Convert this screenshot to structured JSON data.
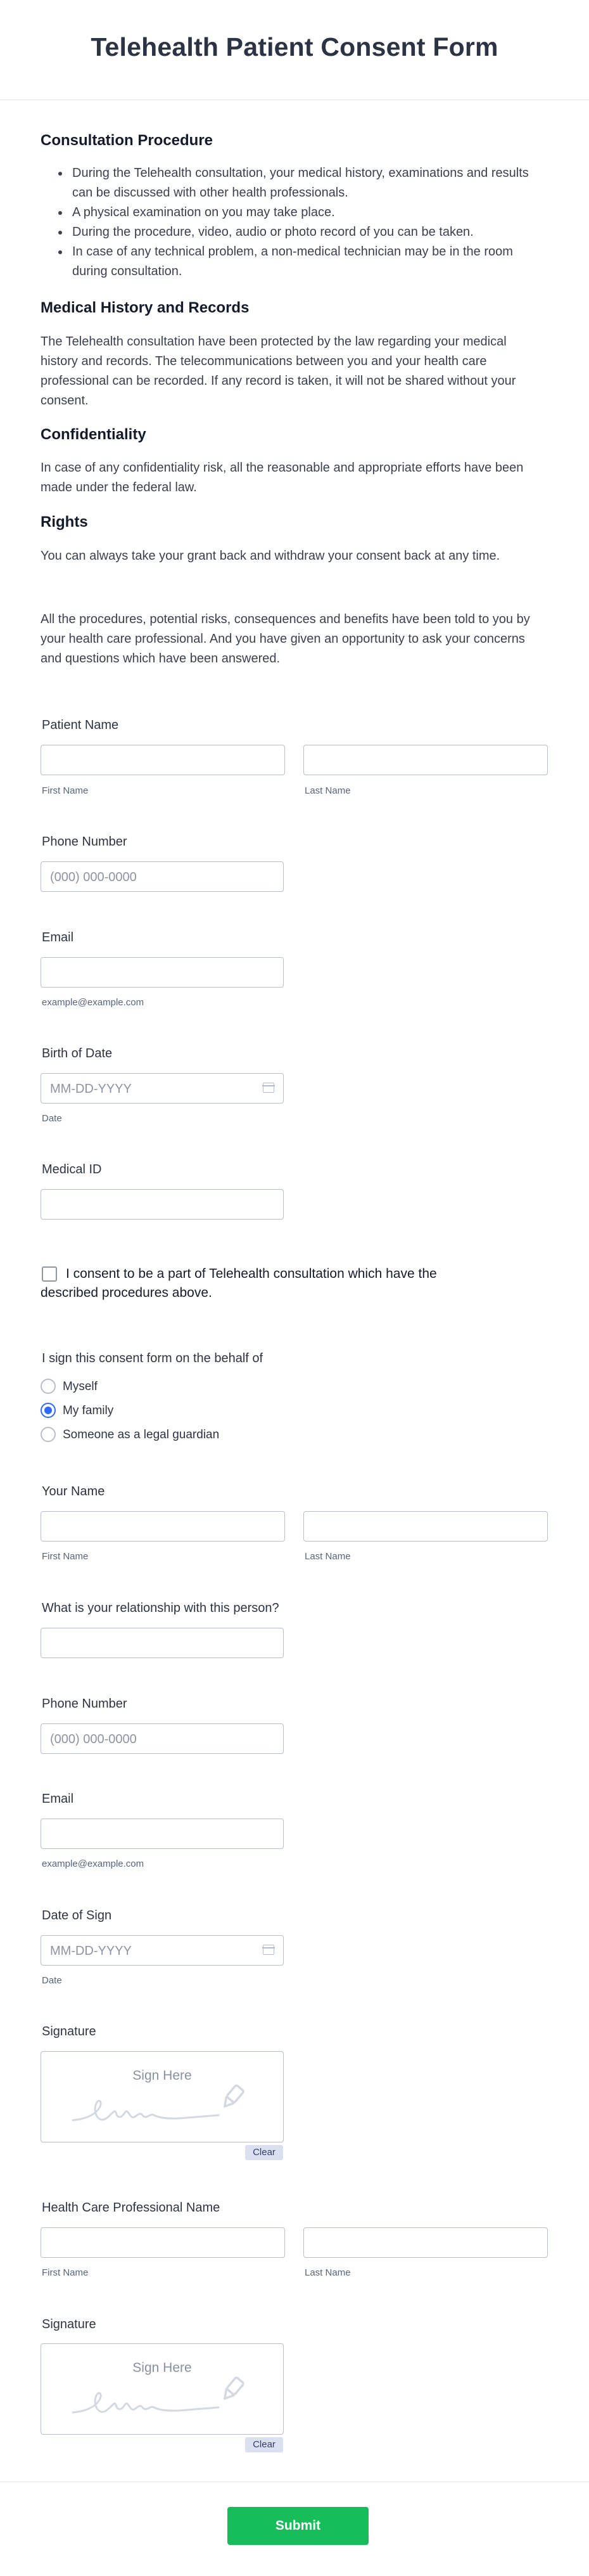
{
  "form": {
    "title": "Telehealth Patient Consent Form"
  },
  "sections": {
    "consultation": {
      "heading": "Consultation Procedure",
      "bullets": [
        "During the Telehealth consultation, your medical history, examinations and results can be discussed with other health professionals.",
        "A physical examination on you may take place.",
        "During the procedure, video, audio or photo record of you can be taken.",
        "In case of any technical problem, a non-medical technician may be in the room during consultation."
      ]
    },
    "history": {
      "heading": "Medical History and Records",
      "text": "The Telehealth consultation have been protected by the law regarding your medical history and records. The telecommunications between you and your health care professional can be recorded. If any record is taken, it will not be shared without your consent."
    },
    "confidentiality": {
      "heading": "Confidentiality",
      "text": "In case of any confidentiality risk, all the reasonable and appropriate efforts have been made under the federal law."
    },
    "rights": {
      "heading": "Rights",
      "text": "You can always take your grant back and withdraw your consent back at any time."
    },
    "closing": {
      "text": "All the procedures, potential risks, consequences and benefits have been told to you by your health care professional. And you have given an opportunity to ask your concerns and questions which have been answered."
    }
  },
  "fields": {
    "patient_name": {
      "label": "Patient Name",
      "first": "First Name",
      "last": "Last Name"
    },
    "phone": {
      "label": "Phone Number",
      "placeholder": "(000) 000-0000"
    },
    "email": {
      "label": "Email",
      "hint": "example@example.com"
    },
    "birth_date": {
      "label": "Birth of Date",
      "placeholder": "MM-DD-YYYY",
      "hint": "Date"
    },
    "medical_id": {
      "label": "Medical ID"
    },
    "consent": {
      "text": "I consent to be a part of Telehealth consultation which have the described procedures above.",
      "checked": false
    },
    "behalf": {
      "label": "I sign this consent form on the behalf of",
      "options": [
        "Myself",
        "My family",
        "Someone as a legal guardian"
      ],
      "selected": "My family"
    },
    "your_name": {
      "label": "Your Name",
      "first": "First Name",
      "last": "Last Name"
    },
    "relationship": {
      "label": "What is your relationship with this person?"
    },
    "phone2": {
      "label": "Phone Number",
      "placeholder": "(000) 000-0000"
    },
    "email2": {
      "label": "Email",
      "hint": "example@example.com"
    },
    "sign_date": {
      "label": "Date of Sign",
      "placeholder": "MM-DD-YYYY",
      "hint": "Date"
    },
    "signature1": {
      "label": "Signature",
      "pad_text": "Sign Here",
      "clear": "Clear"
    },
    "hcp_name": {
      "label": "Health Care Professional Name",
      "first": "First Name",
      "last": "Last Name"
    },
    "signature2": {
      "label": "Signature",
      "pad_text": "Sign Here",
      "clear": "Clear"
    }
  },
  "submit": {
    "label": "Submit"
  },
  "colors": {
    "submit": "#18bd5b",
    "radio_selected": "#2e69ff",
    "text": "#2c3345",
    "border": "#b8bdc9"
  }
}
